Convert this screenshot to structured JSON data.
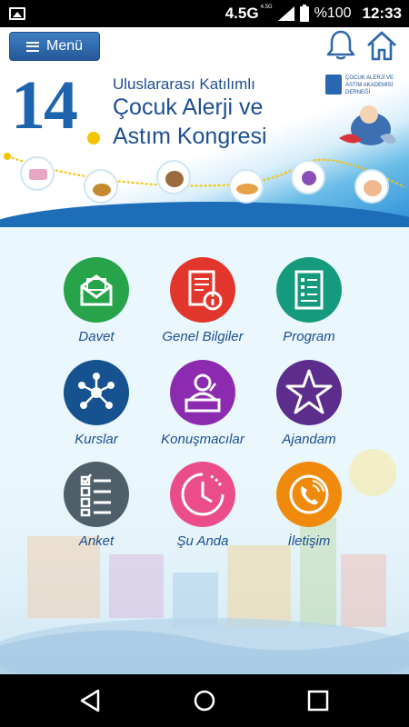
{
  "status_bar": {
    "network": "4.5G",
    "network_sub": "4.5G",
    "battery": "%100",
    "time": "12:33"
  },
  "app_bar": {
    "menu_label": "Menü",
    "icons": [
      "bell-icon",
      "home-icon"
    ]
  },
  "banner": {
    "number": "14",
    "line1": "Uluslararası Katılımlı",
    "line2": "Çocuk Alerji ve",
    "line3": "Astım Kongresi",
    "logo_text": "ÇOCUK ALERJİ VE ASTIM AKADEMİSİ DERNEĞİ"
  },
  "menu_items": [
    {
      "label": "Davet",
      "icon": "envelope-icon",
      "color": "#27a349"
    },
    {
      "label": "Genel Bilgiler",
      "icon": "info-document-icon",
      "color": "#e2352b"
    },
    {
      "label": "Program",
      "icon": "document-list-icon",
      "color": "#169a7d"
    },
    {
      "label": "Kurslar",
      "icon": "network-icon",
      "color": "#15528f"
    },
    {
      "label": "Konuşmacılar",
      "icon": "speaker-icon",
      "color": "#8c2bb0"
    },
    {
      "label": "Ajandam",
      "icon": "star-icon",
      "color": "#5c2d8c"
    },
    {
      "label": "Anket",
      "icon": "checklist-icon",
      "color": "#4f5f6a"
    },
    {
      "label": "Şu Anda",
      "icon": "clock-icon",
      "color": "#ea4d8a"
    },
    {
      "label": "İletişim",
      "icon": "phone-icon",
      "color": "#f08a0c"
    }
  ],
  "colors": {
    "brand_blue": "#1d4f93",
    "menu_button": "#2d68ad"
  }
}
